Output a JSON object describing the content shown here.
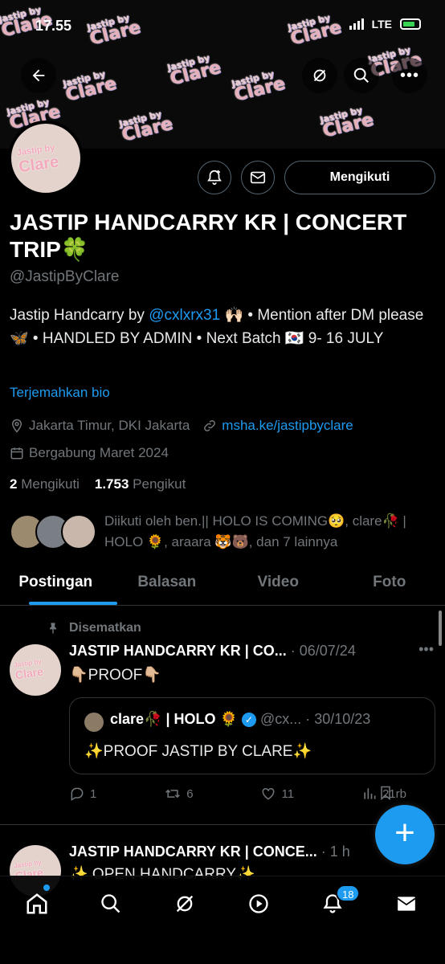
{
  "status_bar": {
    "time": "17.55",
    "network": "LTE"
  },
  "banner_text": {
    "line1": "Jastip by",
    "line2": "Clare"
  },
  "profile": {
    "follow_label": "Mengikuti",
    "name": "JASTIP HANDCARRY KR | CONCERT TRIP🍀",
    "handle": "@JastipByClare",
    "bio_prefix": "Jastip Handcarry by ",
    "bio_mention": "@cxlxrx31",
    "bio_suffix": " 🙌🏻 • Mention after DM please🦋 • HANDLED BY ADMIN • Next Batch 🇰🇷 9- 16 JULY",
    "translate_label": "Terjemahkan bio",
    "location": "Jakarta Timur, DKI Jakarta",
    "website": "msha.ke/jastipbyclare",
    "joined": "Bergabung Maret 2024",
    "following_count": "2",
    "following_label": "Mengikuti",
    "followers_count": "1.753",
    "followers_label": "Pengikut",
    "followed_by": "Diikuti oleh ben.|| HOLO IS COMING🥺, clare🥀 | HOLO 🌻, araara 🐯🐻, dan 7 lainnya"
  },
  "tabs": [
    "Postingan",
    "Balasan",
    "Video",
    "Foto"
  ],
  "pinned_post": {
    "pinned_label": "Disematkan",
    "author": "JASTIP HANDCARRY KR | CO...",
    "date": "· 06/07/24",
    "text": "👇🏼PROOF👇🏼",
    "quote": {
      "author": "clare🥀 | HOLO 🌻",
      "handle_date": "@cx... · 30/10/23",
      "text": "✨PROOF JASTIP BY CLARE✨"
    },
    "replies": "1",
    "reposts": "6",
    "likes": "11",
    "views": "21rb"
  },
  "second_post": {
    "author": "JASTIP HANDCARRY KR | CONCE...",
    "time": "· 1 h",
    "text": "✨ OPEN HANDCARRY✨"
  },
  "fab_label": "+",
  "notifications_badge": "18",
  "avatar_logo": {
    "line1": "Jastip by",
    "line2": "Clare"
  },
  "colors": {
    "accent": "#1d9bf0",
    "background": "#000000",
    "muted": "#71767b"
  }
}
